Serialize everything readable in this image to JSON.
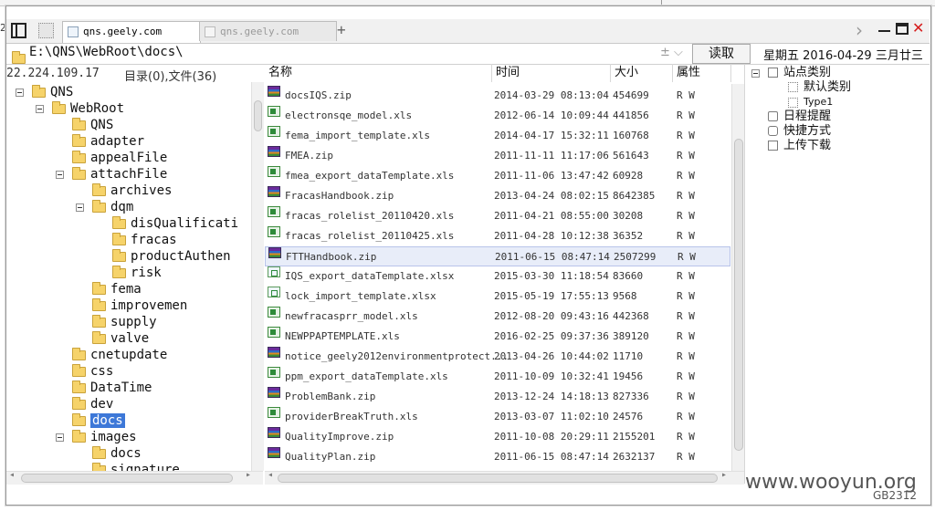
{
  "window": {
    "tabs": [
      {
        "label": "qns.geely.com",
        "active": true
      },
      {
        "label": "qns.geely.com",
        "active": false
      }
    ],
    "add_tab_glyph": "+",
    "controls": {
      "next": "›",
      "minimize": "–",
      "maximize": "□",
      "close": "✕"
    }
  },
  "address": {
    "path": "E:\\QNS\\WebRoot\\docs\\",
    "right_glyphs": "± ⌵",
    "read_button": "读取",
    "date": "星期五 2016-04-29 三月廿三"
  },
  "status": {
    "ip": "22.224.109.17",
    "summary": "目录(0),文件(36)"
  },
  "tree": [
    {
      "label": "QNS",
      "depth": 0,
      "toggle": true
    },
    {
      "label": "WebRoot",
      "depth": 1,
      "toggle": true
    },
    {
      "label": "QNS",
      "depth": 2
    },
    {
      "label": "adapter",
      "depth": 2
    },
    {
      "label": "appealFile",
      "depth": 2
    },
    {
      "label": "attachFile",
      "depth": 2,
      "toggle": true
    },
    {
      "label": "archives",
      "depth": 3
    },
    {
      "label": "dqm",
      "depth": 3,
      "toggle": true
    },
    {
      "label": "disQualificati",
      "depth": 4
    },
    {
      "label": "fracas",
      "depth": 4
    },
    {
      "label": "productAuthen",
      "depth": 4
    },
    {
      "label": "risk",
      "depth": 4
    },
    {
      "label": "fema",
      "depth": 3
    },
    {
      "label": "improvemen",
      "depth": 3
    },
    {
      "label": "supply",
      "depth": 3
    },
    {
      "label": "valve",
      "depth": 3
    },
    {
      "label": "cnetupdate",
      "depth": 2
    },
    {
      "label": "css",
      "depth": 2
    },
    {
      "label": "DataTime",
      "depth": 2
    },
    {
      "label": "dev",
      "depth": 2
    },
    {
      "label": "docs",
      "depth": 2,
      "selected": true
    },
    {
      "label": "images",
      "depth": 2,
      "toggle": true
    },
    {
      "label": "docs",
      "depth": 3
    },
    {
      "label": "signature",
      "depth": 3
    }
  ],
  "columns": {
    "name": "名称",
    "time": "时间",
    "size": "大小",
    "attr": "属性"
  },
  "files": [
    {
      "name": "docsIQS.zip",
      "time": "2014-03-29 08:13:04",
      "size": "454699",
      "attr": "R W",
      "type": "zip"
    },
    {
      "name": "electronsqe_model.xls",
      "time": "2012-06-14 10:09:44",
      "size": "441856",
      "attr": "R W",
      "type": "xls"
    },
    {
      "name": "fema_import_template.xls",
      "time": "2014-04-17 15:32:11",
      "size": "160768",
      "attr": "R W",
      "type": "xls"
    },
    {
      "name": "FMEA.zip",
      "time": "2011-11-11 11:17:06",
      "size": "561643",
      "attr": "R W",
      "type": "zip"
    },
    {
      "name": "fmea_export_dataTemplate.xls",
      "time": "2011-11-06 13:47:42",
      "size": "60928",
      "attr": "R W",
      "type": "xls"
    },
    {
      "name": "FracasHandbook.zip",
      "time": "2013-04-24 08:02:15",
      "size": "8642385",
      "attr": "R W",
      "type": "zip"
    },
    {
      "name": "fracas_rolelist_20110420.xls",
      "time": "2011-04-21 08:55:00",
      "size": "30208",
      "attr": "R W",
      "type": "xls"
    },
    {
      "name": "fracas_rolelist_20110425.xls",
      "time": "2011-04-28 10:12:38",
      "size": "36352",
      "attr": "R W",
      "type": "xls"
    },
    {
      "name": "FTTHandbook.zip",
      "time": "2011-06-15 08:47:14",
      "size": "2507299",
      "attr": "R W",
      "type": "zip",
      "highlight": true
    },
    {
      "name": "IQS_export_dataTemplate.xlsx",
      "time": "2015-03-30 11:18:54",
      "size": "83660",
      "attr": "R W",
      "type": "xlsx"
    },
    {
      "name": "lock_import_template.xlsx",
      "time": "2015-05-19 17:55:13",
      "size": "9568",
      "attr": "R W",
      "type": "xlsx"
    },
    {
      "name": "newfracasprr_model.xls",
      "time": "2012-08-20 09:43:16",
      "size": "442368",
      "attr": "R W",
      "type": "xls"
    },
    {
      "name": "NEWPPAPTEMPLATE.xls",
      "time": "2016-02-25 09:37:36",
      "size": "389120",
      "attr": "R W",
      "type": "xls"
    },
    {
      "name": "notice_geely2012environmentprotect...",
      "time": "2013-04-26 10:44:02",
      "size": "11710",
      "attr": "R W",
      "type": "zip"
    },
    {
      "name": "ppm_export_dataTemplate.xls",
      "time": "2011-10-09 10:32:41",
      "size": "19456",
      "attr": "R W",
      "type": "xls"
    },
    {
      "name": "ProblemBank.zip",
      "time": "2013-12-24 14:18:13",
      "size": "827336",
      "attr": "R W",
      "type": "zip"
    },
    {
      "name": "providerBreakTruth.xls",
      "time": "2013-03-07 11:02:10",
      "size": "24576",
      "attr": "R W",
      "type": "xls"
    },
    {
      "name": "QualityImprove.zip",
      "time": "2011-10-08 20:29:11",
      "size": "2155201",
      "attr": "R W",
      "type": "zip"
    },
    {
      "name": "QualityPlan.zip",
      "time": "2011-06-15 08:47:14",
      "size": "2632137",
      "attr": "R W",
      "type": "zip"
    }
  ],
  "right_panel": {
    "items": [
      {
        "label": "站点类别",
        "level": 0
      },
      {
        "label": "默认类别",
        "level": 1
      },
      {
        "label": "Type1",
        "level": 1
      },
      {
        "label": "日程提醒",
        "level": 0
      },
      {
        "label": "快捷方式",
        "level": 0
      },
      {
        "label": "上传下载",
        "level": 0
      }
    ]
  },
  "watermark": {
    "site": "www.wooyun.org",
    "code": "GB2312"
  },
  "colors": {
    "selection": "#3d78d8",
    "close": "#d61c1c",
    "row_highlight": "#e8edf9"
  }
}
